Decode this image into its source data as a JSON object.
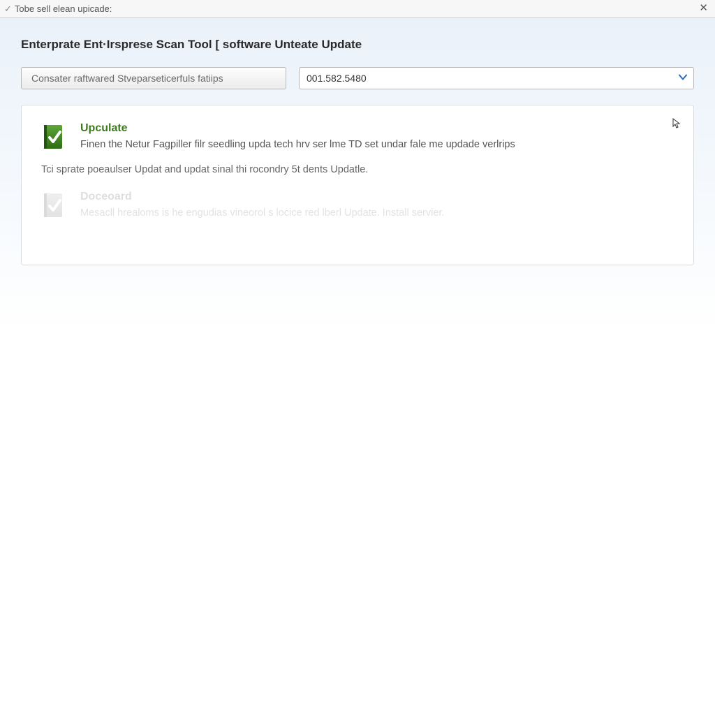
{
  "window": {
    "title": "Tobe sell elean upicade:"
  },
  "header": {
    "page_title": "Enterprate Ent·Irsprese Scan Tool [ software Unteate Update"
  },
  "toolbar": {
    "button_label": "Consater raftwared Stveparseticerfuls fatiips",
    "dropdown_value": "001.582.5480"
  },
  "panel": {
    "item1": {
      "title": "Upculate",
      "desc": "Finen the Netur Fagpiller filr seedling upda tech hrv ser lme TD set undar fale me updade verlrips"
    },
    "sub_note": "Tci sprate poeaulser Updat and updat sinal thi rocondry 5t dents Updatle.",
    "item2": {
      "title": "Doceoard",
      "desc": "Mesacll hrealoms is he engudias vineorol s locice red lberl Update. Install servier."
    }
  }
}
